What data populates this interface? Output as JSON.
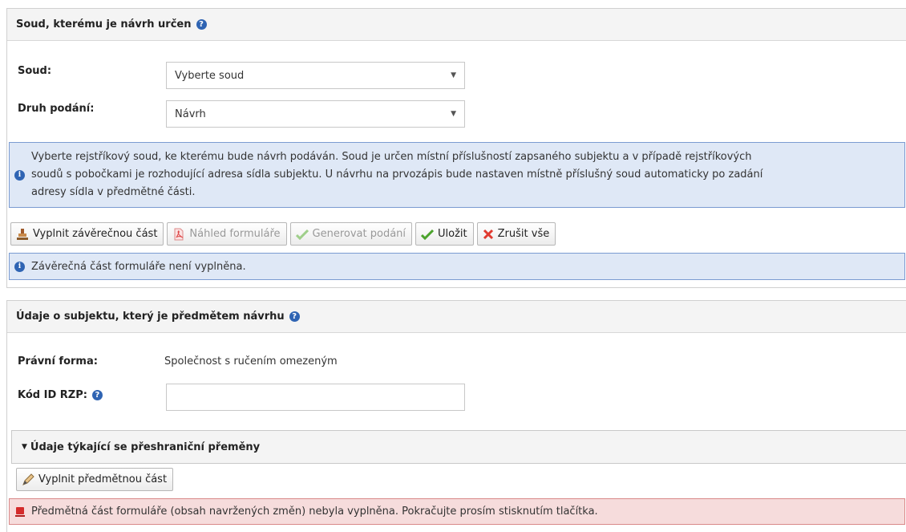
{
  "court_section": {
    "title": "Soud, kterému je návrh určen",
    "court_label": "Soud:",
    "court_value": "Vyberte soud",
    "filing_type_label": "Druh podání:",
    "filing_type_value": "Návrh",
    "info_text_line1": "Vyberte rejstříkový soud, ke kterému bude návrh podáván. Soud je určen místní příslušností zapsaného subjektu a v případě rejstříkových",
    "info_text_line2": "soudů s pobočkami je rozhodující adresa sídla subjektu. U návrhu na prvozápis bude nastaven místně příslušný soud automaticky po zadání",
    "info_text_line3": "adresy sídla v předmětné části.",
    "buttons": {
      "fill_final": "Vyplnit závěrečnou část",
      "preview": "Náhled formuláře",
      "generate": "Generovat podání",
      "save": "Uložit",
      "cancel_all": "Zrušit vše"
    },
    "status_text": "Závěrečná část formuláře není vyplněna."
  },
  "subject_section": {
    "title": "Údaje o subjektu, který je předmětem návrhu",
    "legal_form_label": "Právní forma:",
    "legal_form_value": "Společnost s ručením omezeným",
    "rzp_label": "Kód ID RZP:",
    "rzp_value": "",
    "cross_border_title": "Údaje týkající se přeshraniční přeměny",
    "fill_subject_button": "Vyplnit předmětnou část",
    "error_text": "Předmětná část formuláře (obsah navržených změn) nebyla vyplněna. Pokračujte prosím stisknutím tlačítka."
  },
  "icons": {
    "help": "help-icon",
    "info": "info-icon",
    "stamp": "stamp-icon",
    "pdf": "pdf-icon",
    "check": "check-icon",
    "cross": "cross-icon",
    "pencil": "pencil-icon",
    "alert": "alert-icon"
  },
  "colors": {
    "info_bg": "#dfe8f6",
    "info_border": "#7b9bd1",
    "error_bg": "#f6dcdc",
    "error_border": "#d98989",
    "accent_blue": "#2f64b3"
  }
}
